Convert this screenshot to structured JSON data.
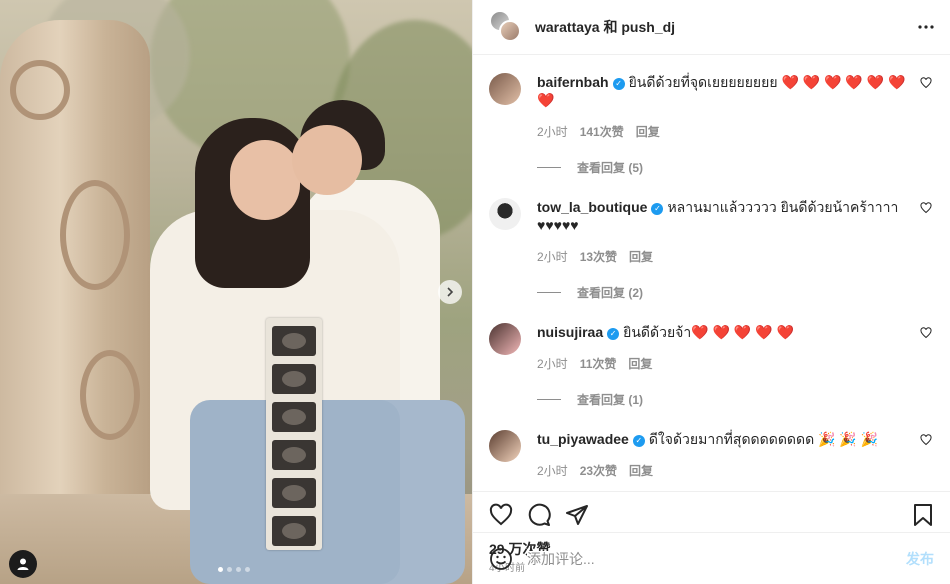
{
  "header": {
    "title": "warattaya 和 push_dj",
    "more_icon": "more-horizontal-icon"
  },
  "media": {
    "next_icon": "chevron-right-icon",
    "slide_count": 4,
    "active_slide": 1
  },
  "comments": [
    {
      "username": "baifernbah",
      "verified": true,
      "text": "ยินดีด้วยที่จุดเยยยยยยยย",
      "hearts": "❤️ ❤️ ❤️ ❤️ ❤️ ❤️ ❤️",
      "time": "2小时",
      "likes": "141次赞",
      "reply_label": "回复",
      "view_replies": "查看回复 (5)",
      "avatar_color": "#c9a28c"
    },
    {
      "username": "tow_la_boutique",
      "verified": true,
      "text": "หลานมาแล้ววววว ยินดีด้วยน้าคร้าาาา ♥♥♥♥♥",
      "hearts": "",
      "time": "2小时",
      "likes": "13次赞",
      "reply_label": "回复",
      "view_replies": "查看回复 (2)",
      "avatar_color": "#d8d8d8"
    },
    {
      "username": "nuisujiraa",
      "verified": true,
      "text": "ยินดีด้วยจ้า",
      "hearts": "❤️ ❤️ ❤️ ❤️ ❤️",
      "time": "2小时",
      "likes": "11次赞",
      "reply_label": "回复",
      "view_replies": "查看回复 (1)",
      "avatar_color": "#e3a7a4"
    },
    {
      "username": "tu_piyawadee",
      "verified": true,
      "text": "ดีใจด้วยมากที่สุดดดดดดดด",
      "hearts": "🎉 🎉 🎉",
      "time": "2小时",
      "likes": "23次赞",
      "reply_label": "回复",
      "view_replies": "",
      "avatar_color": "#e2c4a8"
    }
  ],
  "actions": {
    "like_icon": "heart-icon",
    "comment_icon": "comment-icon",
    "share_icon": "send-icon",
    "save_icon": "bookmark-icon"
  },
  "likes_count": "29 万次赞",
  "posted_time": "4小时前",
  "add_comment": {
    "placeholder": "添加评论...",
    "post_label": "发布",
    "emoji_icon": "emoji-icon"
  },
  "colors": {
    "verified": "#1d9bf0",
    "heart": "#ed1c24",
    "post_button": "#b2dffc",
    "muted_text": "#8e8e8e"
  }
}
